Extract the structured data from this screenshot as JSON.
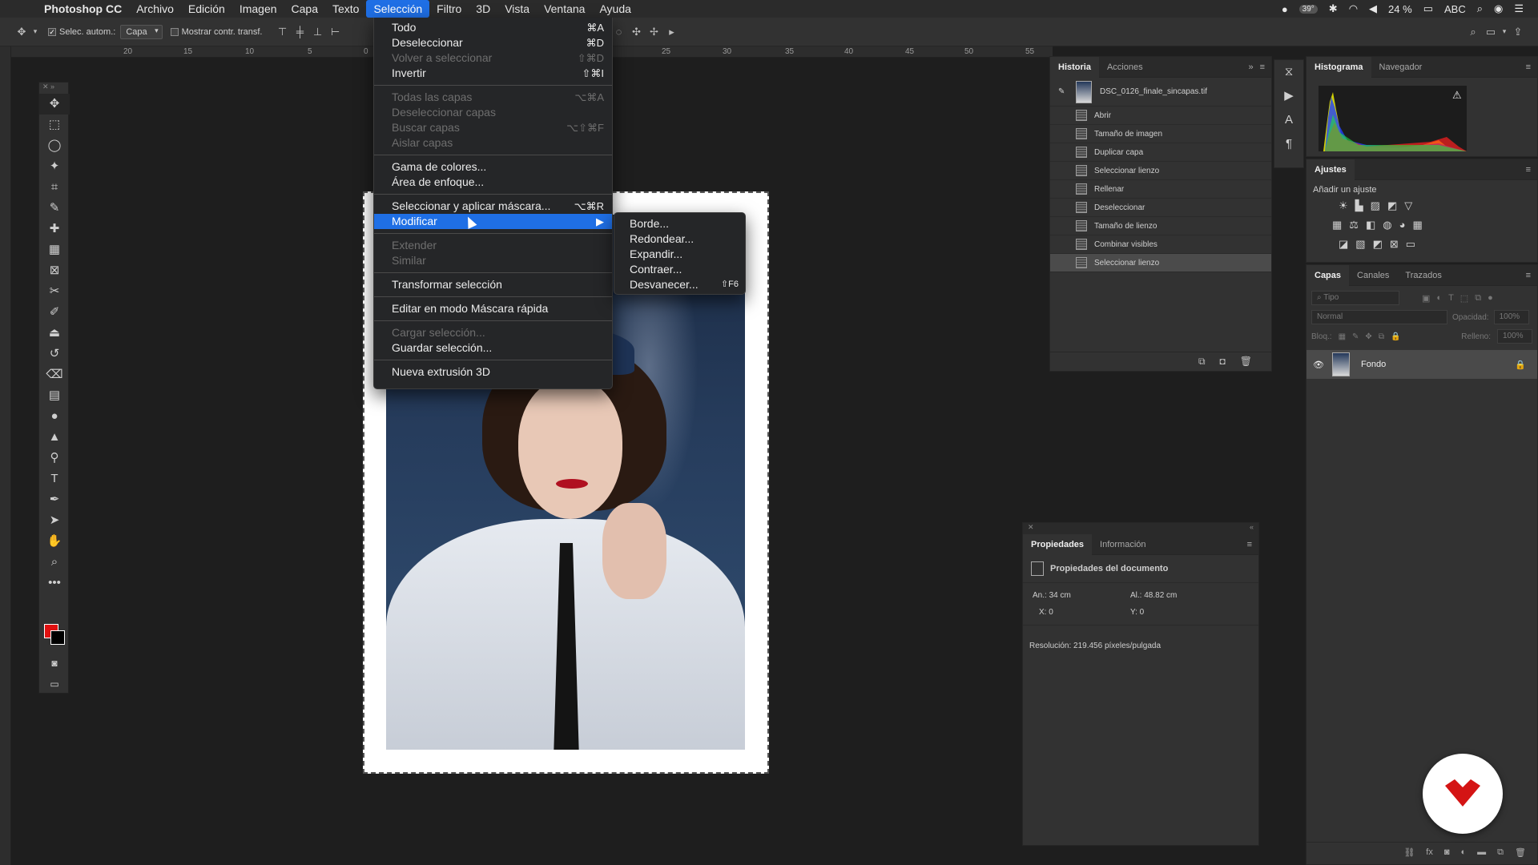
{
  "menubar": {
    "app_name": "Photoshop CC",
    "items": [
      "Archivo",
      "Edición",
      "Imagen",
      "Capa",
      "Texto",
      "Selección",
      "Filtro",
      "3D",
      "Vista",
      "Ventana",
      "Ayuda"
    ],
    "active_item": "Selección",
    "status": {
      "temp": "39°",
      "battery": "24 %",
      "keyboard": "ABC"
    }
  },
  "options_bar": {
    "auto_select_label": "Selec. autom.:",
    "auto_select_value": "Capa",
    "transform_controls_label": "Mostrar contr. transf."
  },
  "ruler": {
    "ticks": [
      "20",
      "15",
      "10",
      "5",
      "0",
      "25",
      "30",
      "35",
      "40",
      "45",
      "50",
      "55"
    ]
  },
  "selection_menu": {
    "groups": [
      [
        {
          "label": "Todo",
          "shortcut": "⌘A",
          "enabled": true
        },
        {
          "label": "Deseleccionar",
          "shortcut": "⌘D",
          "enabled": true
        },
        {
          "label": "Volver a seleccionar",
          "shortcut": "⇧⌘D",
          "enabled": false
        },
        {
          "label": "Invertir",
          "shortcut": "⇧⌘I",
          "enabled": true
        }
      ],
      [
        {
          "label": "Todas las capas",
          "shortcut": "⌥⌘A",
          "enabled": false
        },
        {
          "label": "Deseleccionar capas",
          "shortcut": "",
          "enabled": false
        },
        {
          "label": "Buscar capas",
          "shortcut": "⌥⇧⌘F",
          "enabled": false
        },
        {
          "label": "Aislar capas",
          "shortcut": "",
          "enabled": false
        }
      ],
      [
        {
          "label": "Gama de colores...",
          "shortcut": "",
          "enabled": true
        },
        {
          "label": "Área de enfoque...",
          "shortcut": "",
          "enabled": true
        }
      ],
      [
        {
          "label": "Seleccionar y aplicar máscara...",
          "shortcut": "⌥⌘R",
          "enabled": true
        },
        {
          "label": "Modificar",
          "shortcut": "▶",
          "enabled": true,
          "highlighted": true
        }
      ],
      [
        {
          "label": "Extender",
          "shortcut": "",
          "enabled": false
        },
        {
          "label": "Similar",
          "shortcut": "",
          "enabled": false
        }
      ],
      [
        {
          "label": "Transformar selección",
          "shortcut": "",
          "enabled": true
        }
      ],
      [
        {
          "label": "Editar en modo Máscara rápida",
          "shortcut": "",
          "enabled": true
        }
      ],
      [
        {
          "label": "Cargar selección...",
          "shortcut": "",
          "enabled": false
        },
        {
          "label": "Guardar selección...",
          "shortcut": "",
          "enabled": true
        }
      ],
      [
        {
          "label": "Nueva extrusión 3D",
          "shortcut": "",
          "enabled": true
        }
      ]
    ]
  },
  "modify_submenu": [
    {
      "label": "Borde...",
      "shortcut": ""
    },
    {
      "label": "Redondear...",
      "shortcut": ""
    },
    {
      "label": "Expandir...",
      "shortcut": ""
    },
    {
      "label": "Contraer...",
      "shortcut": ""
    },
    {
      "label": "Desvanecer...",
      "shortcut": "⇧F6"
    }
  ],
  "history_panel": {
    "tabs": [
      "Historia",
      "Acciones"
    ],
    "snapshot": "DSC_0126_finale_sincapas.tif",
    "states": [
      "Abrir",
      "Tamaño de imagen",
      "Duplicar capa",
      "Seleccionar lienzo",
      "Rellenar",
      "Deseleccionar",
      "Tamaño de lienzo",
      "Combinar visibles",
      "Seleccionar lienzo"
    ],
    "active_index": 8
  },
  "histogram_panel": {
    "tabs": [
      "Histograma",
      "Navegador"
    ]
  },
  "adjustments_panel": {
    "title": "Ajustes",
    "subtitle": "Añadir un ajuste"
  },
  "layers_panel": {
    "tabs": [
      "Capas",
      "Canales",
      "Trazados"
    ],
    "search_placeholder": "Tipo",
    "blend_mode": "Normal",
    "opacity_label": "Opacidad:",
    "opacity_value": "100%",
    "lock_label": "Bloq.:",
    "fill_label": "Relleno:",
    "fill_value": "100%",
    "layers": [
      {
        "name": "Fondo"
      }
    ]
  },
  "properties_panel": {
    "tabs": [
      "Propiedades",
      "Información"
    ],
    "title": "Propiedades del documento",
    "width": "An.: 34 cm",
    "height": "Al.: 48.82 cm",
    "x": "X: 0",
    "y": "Y: 0",
    "resolution": "Resolución: 219.456 píxeles/pulgada"
  },
  "colors": {
    "accent": "#1f6fe5",
    "foreground": "#e01010",
    "badge": "#d41414"
  }
}
